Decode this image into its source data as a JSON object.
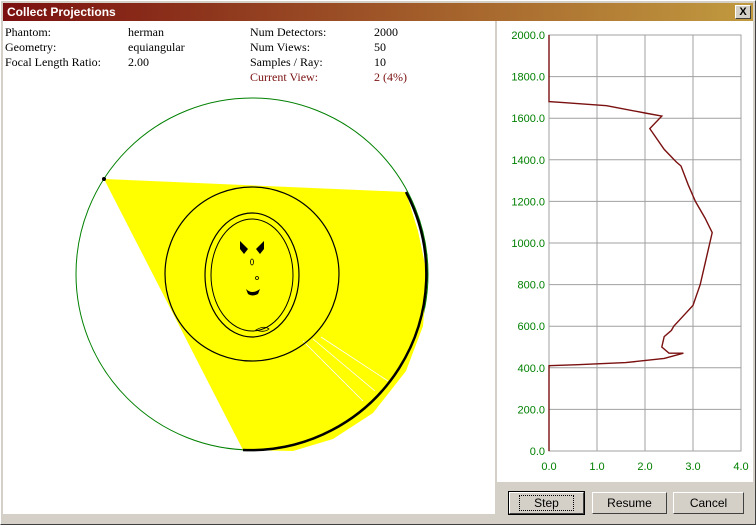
{
  "window": {
    "title": "Collect Projections",
    "close_label": "X"
  },
  "info": {
    "left": [
      {
        "label": "Phantom:",
        "value": "herman"
      },
      {
        "label": "Geometry:",
        "value": "equiangular"
      },
      {
        "label": "Focal Length Ratio:",
        "value": "2.00"
      }
    ],
    "right": [
      {
        "label": "Num Detectors:",
        "value": "2000"
      },
      {
        "label": "Num Views:",
        "value": "50"
      },
      {
        "label": "Samples / Ray:",
        "value": "10"
      },
      {
        "label": "Current View:",
        "value": "2 (4%)"
      }
    ]
  },
  "buttons": {
    "step": "Step",
    "resume": "Resume",
    "cancel": "Cancel"
  },
  "colors": {
    "title_start": "#7b1010",
    "title_end": "#c19a3f",
    "fan": "#ffff00",
    "circle": "#008000",
    "curve": "#7a1010",
    "axis_label": "#008000"
  },
  "chart_data": {
    "type": "line",
    "orientation": "vertical",
    "xlim": [
      0,
      4.0
    ],
    "ylim": [
      0,
      2000
    ],
    "x_ticks": [
      "0.0",
      "1.0",
      "2.0",
      "3.0",
      "4.0"
    ],
    "y_ticks": [
      "0.0",
      "200.0",
      "400.0",
      "600.0",
      "800.0",
      "1000.0",
      "1200.0",
      "1400.0",
      "1600.0",
      "1800.0",
      "2000.0"
    ],
    "grid": true,
    "series": [
      {
        "points": [
          [
            0,
            0
          ],
          [
            0,
            410
          ],
          [
            0.6,
            415
          ],
          [
            1.6,
            425
          ],
          [
            2.4,
            445
          ],
          [
            2.8,
            470
          ],
          [
            2.5,
            470
          ],
          [
            2.35,
            500
          ],
          [
            2.4,
            550
          ],
          [
            2.55,
            580
          ],
          [
            2.6,
            600
          ],
          [
            2.8,
            650
          ],
          [
            3.0,
            700
          ],
          [
            3.15,
            800
          ],
          [
            3.25,
            900
          ],
          [
            3.35,
            1000
          ],
          [
            3.4,
            1050
          ],
          [
            3.25,
            1120
          ],
          [
            3.05,
            1200
          ],
          [
            2.9,
            1280
          ],
          [
            2.75,
            1370
          ],
          [
            2.65,
            1390
          ],
          [
            2.4,
            1450
          ],
          [
            2.1,
            1550
          ],
          [
            2.35,
            1610
          ],
          [
            2.0,
            1625
          ],
          [
            1.2,
            1660
          ],
          [
            0.3,
            1675
          ],
          [
            0,
            1680
          ],
          [
            0,
            2000
          ]
        ]
      }
    ]
  }
}
